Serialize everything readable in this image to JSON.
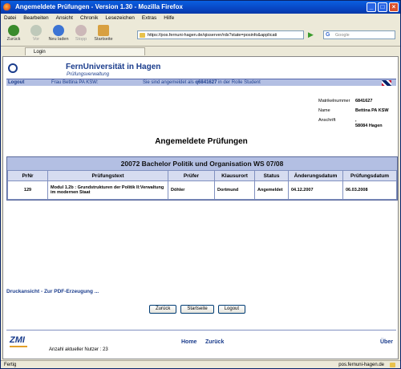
{
  "window": {
    "title": "Angemeldete Prüfungen - Version 1.30 - Mozilla Firefox"
  },
  "menu": [
    "Datei",
    "Bearbeiten",
    "Ansicht",
    "Chronik",
    "Lesezeichen",
    "Extras",
    "Hilfe"
  ],
  "toolbar": {
    "back": "Zurück",
    "forward": "Vor",
    "reload": "Neu laden",
    "stop": "Stopp",
    "home": "Startseite"
  },
  "address": {
    "url": "https://pos.fernuni-hagen.de/qisserver/rds?state=posinfo&applicati"
  },
  "search": {
    "placeholder": "Google"
  },
  "tab": {
    "label": "Login"
  },
  "site": {
    "name": "FernUniversität in Hagen",
    "subtitle": "Prüfungsverwaltung"
  },
  "userbar": {
    "logout": "Logout",
    "user": "Frau Bettina PA KSW:",
    "logged_prefix": "Sie sind angemeldet als",
    "logged_id": "q6841627",
    "logged_suffix": "in der Rolle Student"
  },
  "info": {
    "matrikel_label": "Matrikelnummer",
    "matrikel": "6841627",
    "name_label": "Name",
    "name": "Bettina PA KSW",
    "anschrift_label": "Anschrift",
    "anschrift1": ",",
    "anschrift2": "58084  Hagen"
  },
  "page_title": "Angemeldete Prüfungen",
  "table": {
    "caption": "20072 Bachelor Politik und Organisation WS 07/08",
    "headers": [
      "PrNr",
      "Prüfungstext",
      "Prüfer",
      "Klausurort",
      "Status",
      "Änderungsdatum",
      "Prüfungsdatum"
    ],
    "rows": [
      [
        "129",
        "Modul 1.2b : Grundstrukturen der Politik Il:Verwaltung im modernen Staat",
        "Döhler",
        "Dortmund",
        "Angemeldet",
        "04.12.2007",
        "06.03.2008"
      ]
    ]
  },
  "druck": "Druckansicht - Zur PDF-Erzeugung ...",
  "buttons": {
    "back": "Zurück",
    "home": "Startseite",
    "logout": "Logout"
  },
  "footer": {
    "logo": "ZMI",
    "home": "Home",
    "zurueck": "Zurück",
    "ueber": "Über",
    "nutzer": "Anzahl aktueller Nutzer : 23"
  },
  "status": {
    "text": "Fertig",
    "host": "pos.fernuni-hagen.de"
  }
}
